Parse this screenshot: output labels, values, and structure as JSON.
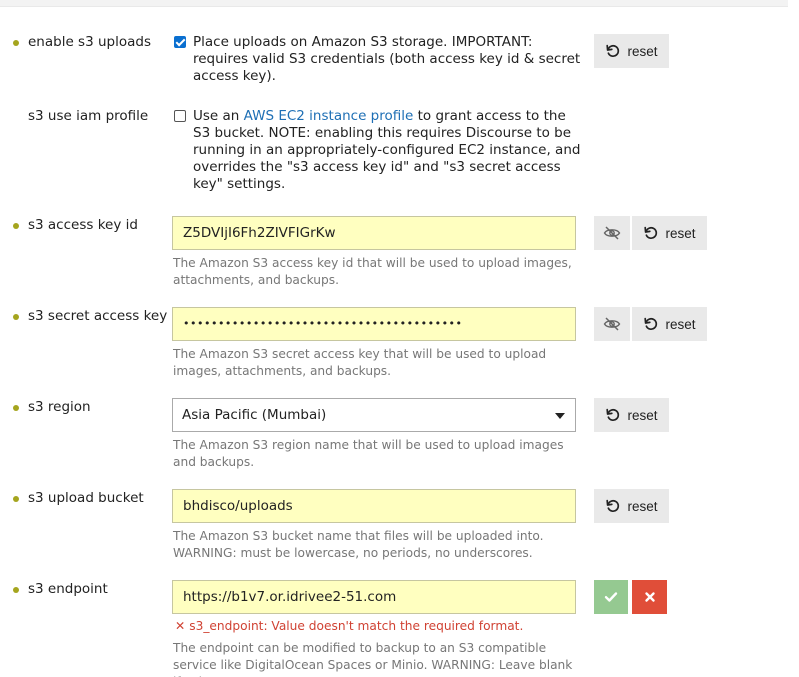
{
  "settings": {
    "enable_s3_uploads": {
      "label": "enable s3 uploads",
      "checked": true,
      "description": "Place uploads on Amazon S3 storage. IMPORTANT: requires valid S3 credentials (both access key id & secret access key).",
      "reset_label": "reset"
    },
    "s3_use_iam_profile": {
      "label": "s3 use iam profile",
      "checked": false,
      "desc_prefix": "Use an ",
      "link_text": "AWS EC2 instance profile",
      "desc_suffix": " to grant access to the S3 bucket. NOTE: enabling this requires Discourse to be running in an appropriately-configured EC2 instance, and overrides the \"s3 access key id\" and \"s3 secret access key\" settings."
    },
    "s3_access_key_id": {
      "label": "s3 access key id",
      "value": "Z5DVIjI6Fh2ZIVFIGrKw",
      "help": "The Amazon S3 access key id that will be used to upload images, attachments, and backups.",
      "reset_label": "reset"
    },
    "s3_secret_access_key": {
      "label": "s3 secret access key",
      "value": "••••••••••••••••••••••••••••••••••••••••",
      "help": "The Amazon S3 secret access key that will be used to upload images, attachments, and backups.",
      "reset_label": "reset"
    },
    "s3_region": {
      "label": "s3 region",
      "selected": "Asia Pacific (Mumbai)",
      "help": "The Amazon S3 region name that will be used to upload images and backups.",
      "reset_label": "reset"
    },
    "s3_upload_bucket": {
      "label": "s3 upload bucket",
      "value": "bhdisco/uploads",
      "help": "The Amazon S3 bucket name that files will be uploaded into. WARNING: must be lowercase, no periods, no underscores.",
      "reset_label": "reset"
    },
    "s3_endpoint": {
      "label": "s3 endpoint",
      "value": "https://b1v7.or.idrivee2-51.com",
      "error": "s3_endpoint: Value doesn't match the required format.",
      "help": "The endpoint can be modified to backup to an S3 compatible service like DigitalOcean Spaces or Minio. WARNING: Leave blank if using"
    }
  },
  "icons": {
    "reset": "rotate-left-icon",
    "eye": "eye-slash-icon",
    "ok": "check-icon",
    "cancel": "times-icon",
    "error": "times-icon"
  },
  "colors": {
    "dot": "#a5a51e",
    "input_bg": "#ffffc0",
    "link": "#1e6fb5",
    "checkbox": "#0a6fd0",
    "ok_button": "#95c991",
    "cancel_button": "#e04e39",
    "error_text": "#d04233"
  }
}
